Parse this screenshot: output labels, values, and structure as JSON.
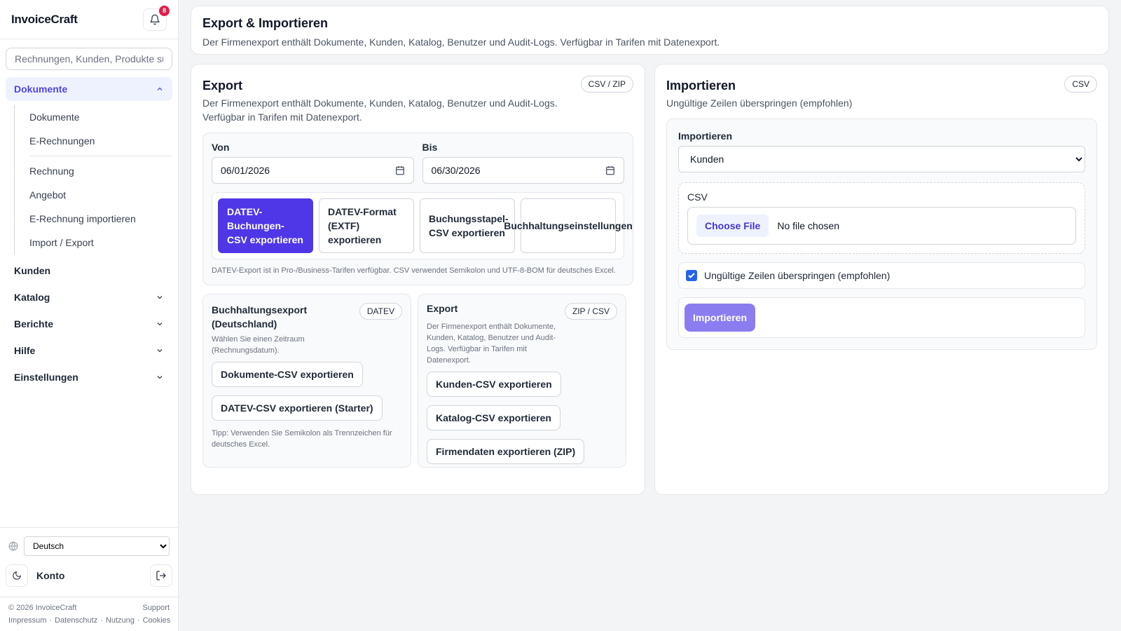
{
  "app": {
    "brand": "InvoiceCraft",
    "notification_count": "8"
  },
  "sidebar": {
    "search_placeholder": "Rechnungen, Kunden, Produkte su",
    "active_group": "Dokumente",
    "subnav": [
      "Dokumente",
      "E-Rechnungen",
      "Rechnung",
      "Angebot",
      "E-Rechnung importieren",
      "Import / Export"
    ],
    "nav": [
      "Kunden",
      "Katalog",
      "Berichte",
      "Hilfe",
      "Einstellungen"
    ],
    "language": "Deutsch",
    "account_label": "Konto",
    "footer": {
      "copyright": "© 2026 InvoiceCraft",
      "support": "Support",
      "links": [
        "Impressum",
        "Datenschutz",
        "Nutzung",
        "Cookies"
      ],
      "separator": "·"
    }
  },
  "header": {
    "title": "Export & Importieren",
    "description": "Der Firmenexport enthält Dokumente, Kunden, Katalog, Benutzer und Audit-Logs. Verfügbar in Tarifen mit Datenexport."
  },
  "export": {
    "title": "Export",
    "badge": "CSV / ZIP",
    "description_line1": "Der Firmenexport enthält Dokumente, Kunden, Katalog, Benutzer und Audit-Logs.",
    "description_line2": "Verfügbar in Tarifen mit Datenexport.",
    "from_label": "Von",
    "from_value": "06/01/2026",
    "to_label": "Bis",
    "to_value": "06/30/2026",
    "tiles": [
      "DATEV-Buchungen-CSV exportieren",
      "DATEV-Format (EXTF) exportieren",
      "Buchungsstapel-CSV exportieren",
      "Buchhaltungseinstellungen"
    ],
    "datev_note": "DATEV-Export ist in Pro-/Business-Tarifen verfügbar. CSV verwendet Semikolon und UTF-8-BOM für deutsches Excel.",
    "accounting": {
      "title": "Buchhaltungsexport (Deutschland)",
      "badge": "DATEV",
      "description": "Wählen Sie einen Zeitraum (Rechnungsdatum).",
      "buttons": [
        "Dokumente-CSV exportieren",
        "DATEV-CSV exportieren (Starter)"
      ],
      "tip": "Tipp: Verwenden Sie Semikolon als Trennzeichen für deutsches Excel."
    },
    "company": {
      "title": "Export",
      "badge": "ZIP / CSV",
      "description": "Der Firmenexport enthält Dokumente, Kunden, Katalog, Benutzer und Audit-Logs. Verfügbar in Tarifen mit Datenexport.",
      "buttons": [
        "Kunden-CSV exportieren",
        "Katalog-CSV exportieren",
        "Firmendaten exportieren (ZIP)"
      ]
    }
  },
  "import": {
    "title": "Importieren",
    "badge": "CSV",
    "description": "Ungültige Zeilen überspringen (empfohlen)",
    "type_label": "Importieren",
    "type_value": "Kunden",
    "csv_label": "CSV",
    "choose_file": "Choose File",
    "no_file": "No file chosen",
    "skip_invalid_label": "Ungültige Zeilen überspringen (empfohlen)",
    "skip_invalid_checked": true,
    "submit": "Importieren"
  },
  "colors": {
    "accent": "#4f37e8",
    "accent_light": "#eef2ff",
    "submit_disabled": "#8b7cf0",
    "badge_red": "#e11d48"
  }
}
